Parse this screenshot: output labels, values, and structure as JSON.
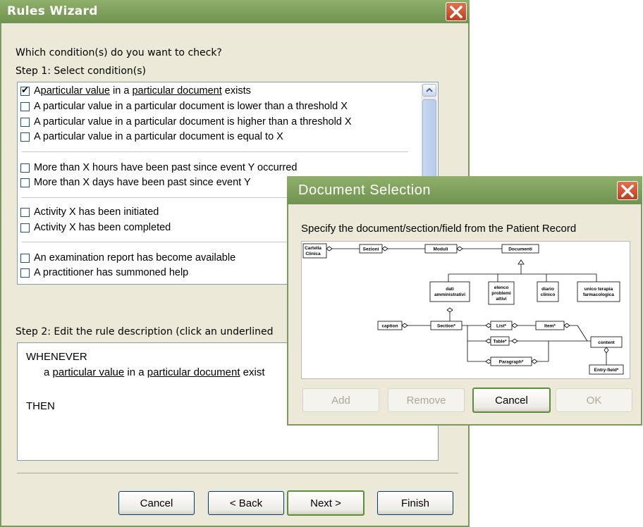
{
  "wizard": {
    "title": "Rules Wizard",
    "prompt": "Which condition(s) do you want to check?",
    "step1": "Step 1: Select condition(s)",
    "conditions": [
      {
        "parts": [
          "A ",
          "particular value",
          " in a ",
          "particular document",
          " exists"
        ],
        "checked": true
      },
      {
        "text": "A particular value in a particular document is lower than a threshold X",
        "checked": false
      },
      {
        "text": "A particular value in a particular document is higher than a threshold X",
        "checked": false
      },
      {
        "text": "A particular value in a particular document is equal to X",
        "checked": false
      },
      {
        "text": "More than X hours have been past since event Y occurred",
        "checked": false
      },
      {
        "text": "More than X days have been past since event Y",
        "checked": false
      },
      {
        "text": "Activity X has been initiated",
        "checked": false
      },
      {
        "text": "Activity X has been completed",
        "checked": false
      },
      {
        "text": "An examination report has become available",
        "checked": false
      },
      {
        "text": "A practitioner has summoned help",
        "checked": false
      }
    ],
    "step2": "Step 2: Edit the rule description (click an underlined",
    "description": {
      "whenever": "WHENEVER",
      "line_parts": [
        "a ",
        "particular value",
        " in a ",
        "particular document",
        " exist"
      ],
      "then": "THEN"
    },
    "buttons": {
      "cancel": "Cancel",
      "back": "< Back",
      "next": "Next >",
      "finish": "Finish"
    }
  },
  "doc_selection": {
    "title": "Document Selection",
    "instruction": "Specify the document/section/field from the Patient Record",
    "diagram_nodes": {
      "cartella": [
        "Cartella",
        "Clinica"
      ],
      "sezioni": "Sezioni",
      "moduli": "Moduli",
      "documenti": "Documenti",
      "dati": [
        "dati",
        "amministrativi"
      ],
      "elenco": [
        "elenco",
        "problemi",
        "attivi"
      ],
      "diario": [
        "diario",
        "clinico"
      ],
      "unico": [
        "unico terapia",
        "farmacologica"
      ],
      "caption": "caption",
      "section": "Section*",
      "list": "List*",
      "item": "Item*",
      "table": "Table*",
      "paragraph": "Paragraph*",
      "content": "content",
      "entry_field": "Entry-field*"
    },
    "buttons": {
      "add": "Add",
      "remove": "Remove",
      "cancel": "Cancel",
      "ok": "OK"
    }
  },
  "colors": {
    "titlebar": "#7fa15c",
    "window_bg": "#ece9d8",
    "close": "#d0502c"
  }
}
